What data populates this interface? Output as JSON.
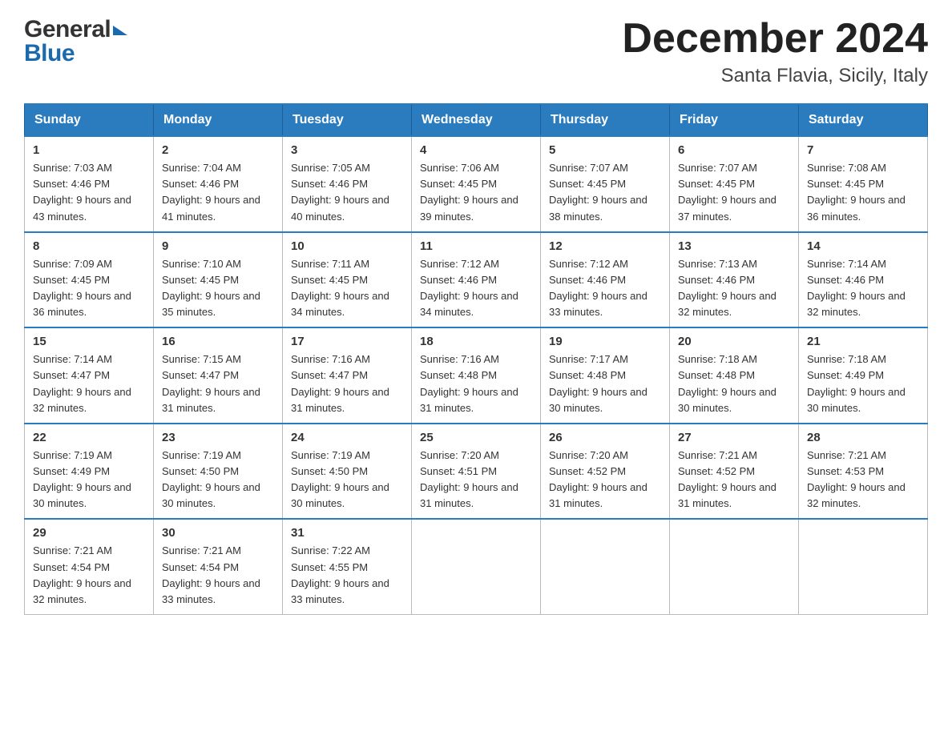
{
  "logo": {
    "general": "General",
    "blue": "Blue",
    "tagline": "Blue"
  },
  "header": {
    "title": "December 2024",
    "subtitle": "Santa Flavia, Sicily, Italy"
  },
  "days_of_week": [
    "Sunday",
    "Monday",
    "Tuesday",
    "Wednesday",
    "Thursday",
    "Friday",
    "Saturday"
  ],
  "weeks": [
    [
      {
        "day": "1",
        "sunrise": "7:03 AM",
        "sunset": "4:46 PM",
        "daylight": "9 hours and 43 minutes."
      },
      {
        "day": "2",
        "sunrise": "7:04 AM",
        "sunset": "4:46 PM",
        "daylight": "9 hours and 41 minutes."
      },
      {
        "day": "3",
        "sunrise": "7:05 AM",
        "sunset": "4:46 PM",
        "daylight": "9 hours and 40 minutes."
      },
      {
        "day": "4",
        "sunrise": "7:06 AM",
        "sunset": "4:45 PM",
        "daylight": "9 hours and 39 minutes."
      },
      {
        "day": "5",
        "sunrise": "7:07 AM",
        "sunset": "4:45 PM",
        "daylight": "9 hours and 38 minutes."
      },
      {
        "day": "6",
        "sunrise": "7:07 AM",
        "sunset": "4:45 PM",
        "daylight": "9 hours and 37 minutes."
      },
      {
        "day": "7",
        "sunrise": "7:08 AM",
        "sunset": "4:45 PM",
        "daylight": "9 hours and 36 minutes."
      }
    ],
    [
      {
        "day": "8",
        "sunrise": "7:09 AM",
        "sunset": "4:45 PM",
        "daylight": "9 hours and 36 minutes."
      },
      {
        "day": "9",
        "sunrise": "7:10 AM",
        "sunset": "4:45 PM",
        "daylight": "9 hours and 35 minutes."
      },
      {
        "day": "10",
        "sunrise": "7:11 AM",
        "sunset": "4:45 PM",
        "daylight": "9 hours and 34 minutes."
      },
      {
        "day": "11",
        "sunrise": "7:12 AM",
        "sunset": "4:46 PM",
        "daylight": "9 hours and 34 minutes."
      },
      {
        "day": "12",
        "sunrise": "7:12 AM",
        "sunset": "4:46 PM",
        "daylight": "9 hours and 33 minutes."
      },
      {
        "day": "13",
        "sunrise": "7:13 AM",
        "sunset": "4:46 PM",
        "daylight": "9 hours and 32 minutes."
      },
      {
        "day": "14",
        "sunrise": "7:14 AM",
        "sunset": "4:46 PM",
        "daylight": "9 hours and 32 minutes."
      }
    ],
    [
      {
        "day": "15",
        "sunrise": "7:14 AM",
        "sunset": "4:47 PM",
        "daylight": "9 hours and 32 minutes."
      },
      {
        "day": "16",
        "sunrise": "7:15 AM",
        "sunset": "4:47 PM",
        "daylight": "9 hours and 31 minutes."
      },
      {
        "day": "17",
        "sunrise": "7:16 AM",
        "sunset": "4:47 PM",
        "daylight": "9 hours and 31 minutes."
      },
      {
        "day": "18",
        "sunrise": "7:16 AM",
        "sunset": "4:48 PM",
        "daylight": "9 hours and 31 minutes."
      },
      {
        "day": "19",
        "sunrise": "7:17 AM",
        "sunset": "4:48 PM",
        "daylight": "9 hours and 30 minutes."
      },
      {
        "day": "20",
        "sunrise": "7:18 AM",
        "sunset": "4:48 PM",
        "daylight": "9 hours and 30 minutes."
      },
      {
        "day": "21",
        "sunrise": "7:18 AM",
        "sunset": "4:49 PM",
        "daylight": "9 hours and 30 minutes."
      }
    ],
    [
      {
        "day": "22",
        "sunrise": "7:19 AM",
        "sunset": "4:49 PM",
        "daylight": "9 hours and 30 minutes."
      },
      {
        "day": "23",
        "sunrise": "7:19 AM",
        "sunset": "4:50 PM",
        "daylight": "9 hours and 30 minutes."
      },
      {
        "day": "24",
        "sunrise": "7:19 AM",
        "sunset": "4:50 PM",
        "daylight": "9 hours and 30 minutes."
      },
      {
        "day": "25",
        "sunrise": "7:20 AM",
        "sunset": "4:51 PM",
        "daylight": "9 hours and 31 minutes."
      },
      {
        "day": "26",
        "sunrise": "7:20 AM",
        "sunset": "4:52 PM",
        "daylight": "9 hours and 31 minutes."
      },
      {
        "day": "27",
        "sunrise": "7:21 AM",
        "sunset": "4:52 PM",
        "daylight": "9 hours and 31 minutes."
      },
      {
        "day": "28",
        "sunrise": "7:21 AM",
        "sunset": "4:53 PM",
        "daylight": "9 hours and 32 minutes."
      }
    ],
    [
      {
        "day": "29",
        "sunrise": "7:21 AM",
        "sunset": "4:54 PM",
        "daylight": "9 hours and 32 minutes."
      },
      {
        "day": "30",
        "sunrise": "7:21 AM",
        "sunset": "4:54 PM",
        "daylight": "9 hours and 33 minutes."
      },
      {
        "day": "31",
        "sunrise": "7:22 AM",
        "sunset": "4:55 PM",
        "daylight": "9 hours and 33 minutes."
      },
      null,
      null,
      null,
      null
    ]
  ],
  "labels": {
    "sunrise_prefix": "Sunrise: ",
    "sunset_prefix": "Sunset: ",
    "daylight_prefix": "Daylight: "
  }
}
